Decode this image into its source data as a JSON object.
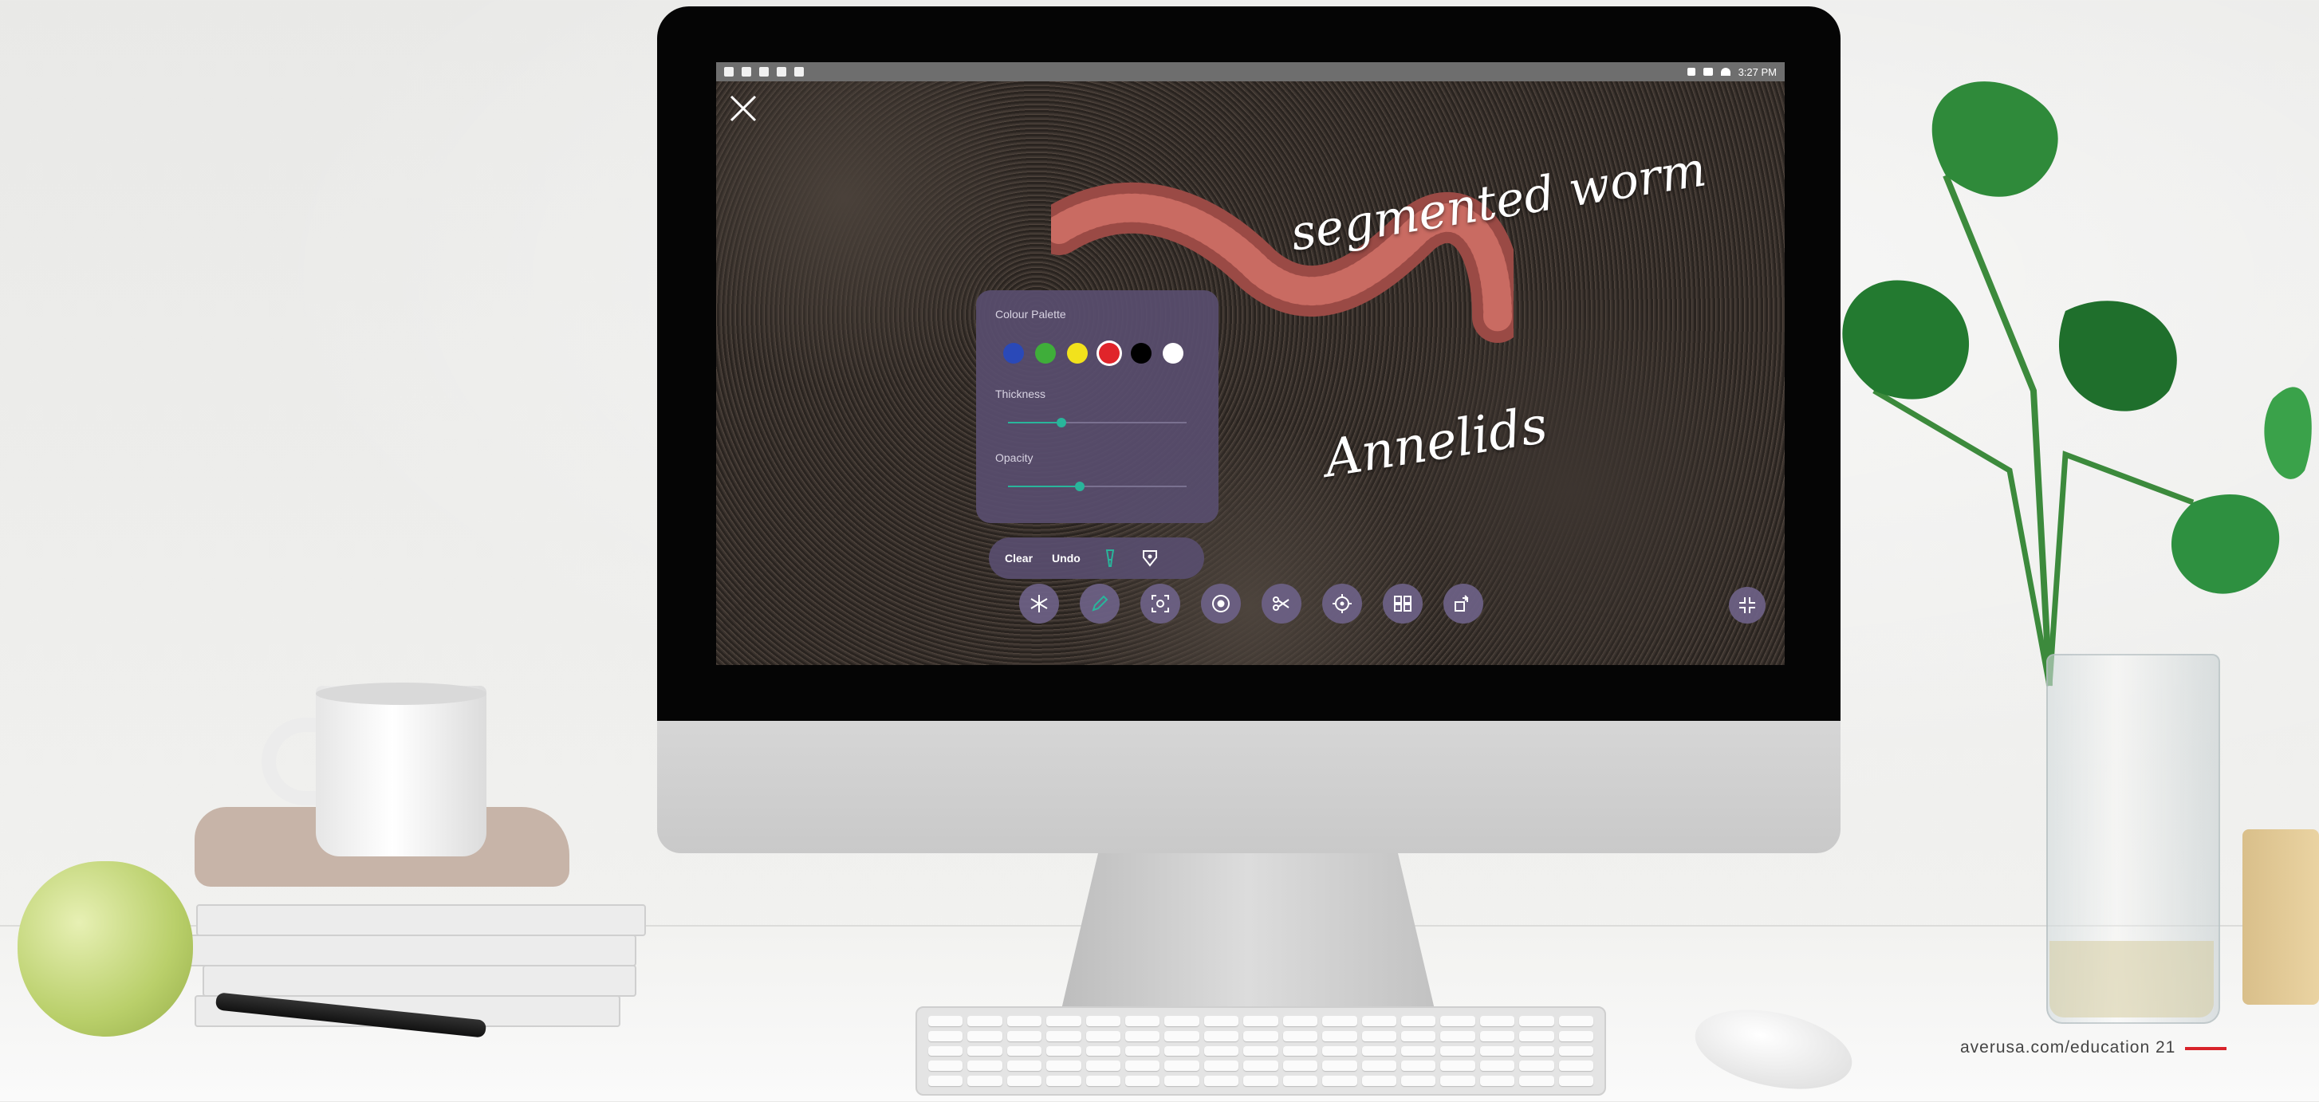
{
  "status_bar": {
    "time": "3:27 PM"
  },
  "annotations": {
    "label_1": "segmented worm",
    "label_2": "Annelids"
  },
  "palette": {
    "title": "Colour Palette",
    "colors": [
      "#2a49b8",
      "#3fae3a",
      "#f2e21c",
      "#e0242a",
      "#000000",
      "#ffffff"
    ],
    "selected_color": "#e0242a",
    "thickness_label": "Thickness",
    "thickness_value": 0.3,
    "opacity_label": "Opacity",
    "opacity_value": 0.4
  },
  "action_bar": {
    "clear_label": "Clear",
    "undo_label": "Undo",
    "icons": [
      "highlighter-icon",
      "pen-nib-icon"
    ]
  },
  "toolbar": {
    "icons": [
      "freeze-icon",
      "pen-icon",
      "capture-icon",
      "record-icon",
      "split-icon",
      "zoom-target-icon",
      "multiview-icon",
      "rotate-icon",
      "minimize-icon"
    ]
  },
  "footer": {
    "text": "averusa.com/education 21",
    "accent_color": "#d8232a"
  }
}
